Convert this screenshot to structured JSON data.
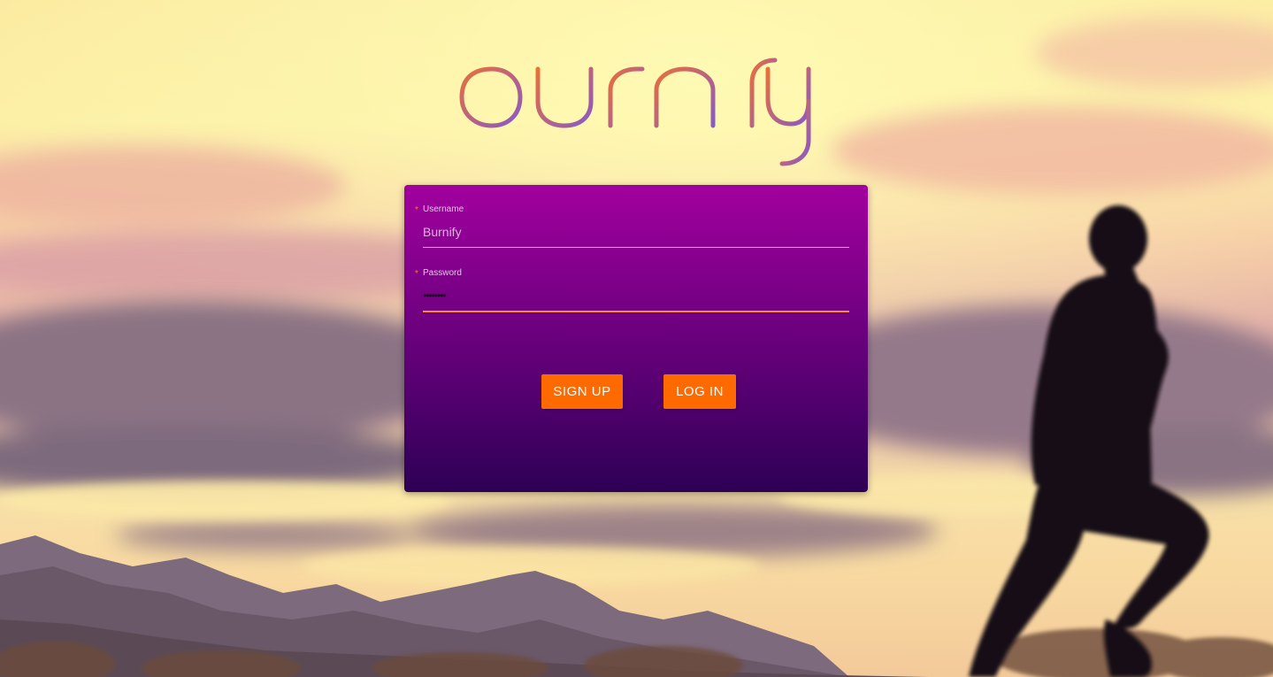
{
  "brand": {
    "logo_text": "burnify"
  },
  "login_form": {
    "username": {
      "label": "Username",
      "value": "Burnify",
      "required_marker": "*"
    },
    "password": {
      "label": "Password",
      "value": "••••••••",
      "required_marker": "*"
    },
    "signup_label": "SIGN UP",
    "login_label": "LOG IN"
  },
  "colors": {
    "accent": "#ff6a00",
    "card_top": "#a2009e",
    "card_bottom": "#2d0054",
    "logo_gradient_start": "#e8703a",
    "logo_gradient_end": "#8a58c8"
  },
  "icons": {
    "background": "runner-at-sunset-photo"
  }
}
